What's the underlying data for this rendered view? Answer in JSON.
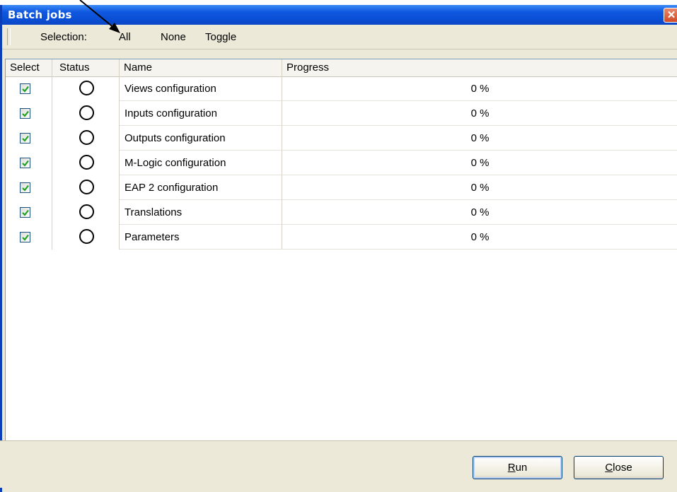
{
  "window": {
    "title": "Batch jobs",
    "close_glyph": "✕"
  },
  "toolbar": {
    "selection_label": "Selection:",
    "all_label": "All",
    "none_label": "None",
    "toggle_label": "Toggle"
  },
  "columns": {
    "select": "Select",
    "status": "Status",
    "name": "Name",
    "progress": "Progress"
  },
  "rows": [
    {
      "checked": true,
      "status": "idle",
      "name": "Views configuration",
      "progress": "0 %"
    },
    {
      "checked": true,
      "status": "idle",
      "name": "Inputs configuration",
      "progress": "0 %"
    },
    {
      "checked": true,
      "status": "idle",
      "name": "Outputs configuration",
      "progress": "0 %"
    },
    {
      "checked": true,
      "status": "idle",
      "name": "M-Logic configuration",
      "progress": "0 %"
    },
    {
      "checked": true,
      "status": "idle",
      "name": "EAP 2 configuration",
      "progress": "0 %"
    },
    {
      "checked": true,
      "status": "idle",
      "name": "Translations",
      "progress": "0 %"
    },
    {
      "checked": true,
      "status": "idle",
      "name": "Parameters",
      "progress": "0 %"
    }
  ],
  "buttons": {
    "run_mnemonic": "R",
    "run_rest": "un",
    "close_mnemonic": "C",
    "close_rest": "lose"
  },
  "colors": {
    "titlebar": "#0a4fd6",
    "checkmark": "#21a121",
    "dialog_bg": "#ece9d8"
  },
  "icons": {
    "annotation": "arrow-pointer-icon",
    "status": "status-circle-icon",
    "check": "checkbox-checked-icon"
  }
}
